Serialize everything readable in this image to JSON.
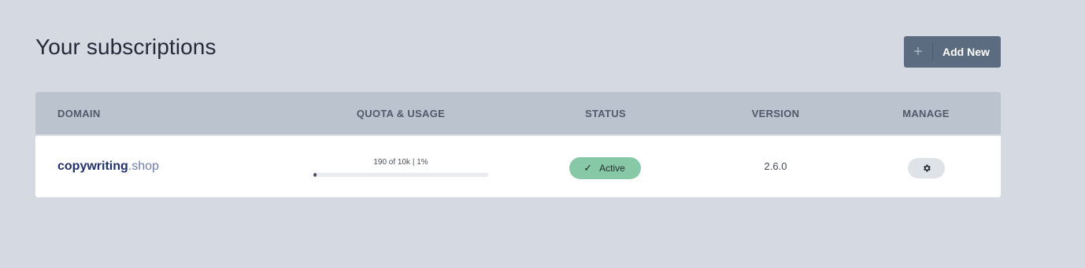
{
  "header": {
    "title": "Your subscriptions",
    "add_button": {
      "icon": "plus-icon",
      "label": "Add New"
    }
  },
  "table": {
    "columns": [
      "DOMAIN",
      "QUOTA & USAGE",
      "STATUS",
      "VERSION",
      "MANAGE"
    ],
    "rows": [
      {
        "domain_name": "copywriting",
        "domain_tld": ".shop",
        "usage_text": "190 of 10k | 1%",
        "usage_fraction": 0.019,
        "status": "Active",
        "status_icon": "check-icon",
        "status_color": "#87c8a6",
        "version": "2.6.0",
        "manage_icon": "gear-icon"
      }
    ]
  },
  "colors": {
    "background": "#d5dae2",
    "button": "#5b6b80",
    "header_row": "#bbc3ce",
    "domain_name": "#22306e",
    "domain_tld": "#6f7fae"
  }
}
